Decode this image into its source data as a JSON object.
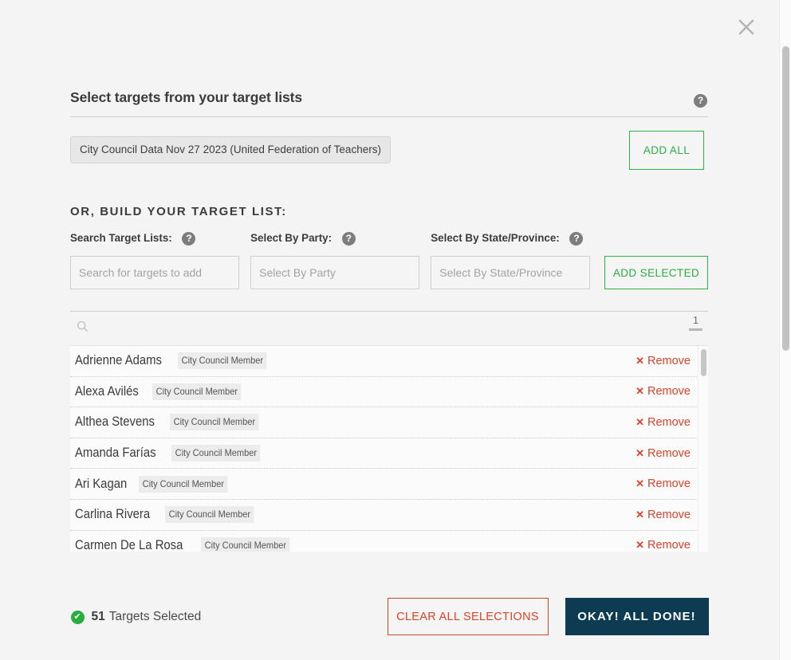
{
  "window": {
    "close_label": "✕"
  },
  "section": {
    "title": "Select targets from your target lists",
    "help": "?",
    "chip_label": "City Council Data Nov 27 2023 (United Federation of Teachers)",
    "add_all_label": "ADD ALL"
  },
  "build": {
    "title": "OR, BUILD YOUR TARGET LIST:",
    "fields": [
      {
        "label": "Search Target Lists:",
        "placeholder": "Search for targets to add",
        "value": "",
        "help": "?"
      },
      {
        "label": "Select By Party:",
        "placeholder": "Select By Party",
        "value": "",
        "help": "?"
      },
      {
        "label": "Select By State/Province:",
        "placeholder": "Select By State/Province",
        "value": "",
        "help": "?"
      }
    ],
    "add_selected_label": "ADD SELECTED"
  },
  "toolbar": {
    "search_icon": "search-icon",
    "page_number": "1"
  },
  "targets": {
    "remove_label": "Remove",
    "remove_icon": "✕",
    "rows": [
      {
        "name": "Adrienne Adams",
        "tag": "City Council Member"
      },
      {
        "name": "Alexa Avilés",
        "tag": "City Council Member"
      },
      {
        "name": "Althea Stevens",
        "tag": "City Council Member"
      },
      {
        "name": "Amanda Farías",
        "tag": "City Council Member"
      },
      {
        "name": "Ari Kagan",
        "tag": "City Council Member"
      },
      {
        "name": "Carlina Rivera",
        "tag": "City Council Member"
      },
      {
        "name": "Carmen De La Rosa",
        "tag": "City Council Member"
      }
    ]
  },
  "footer": {
    "check_icon": "✔",
    "count": "51",
    "count_label": "Targets Selected",
    "clear_label": "CLEAR ALL SELECTIONS",
    "done_label": "OKAY! ALL DONE!"
  },
  "colors": {
    "green": "#27ae3f",
    "red": "#d8432a",
    "navy": "#0d3b52",
    "background": "#f4f4f4"
  }
}
